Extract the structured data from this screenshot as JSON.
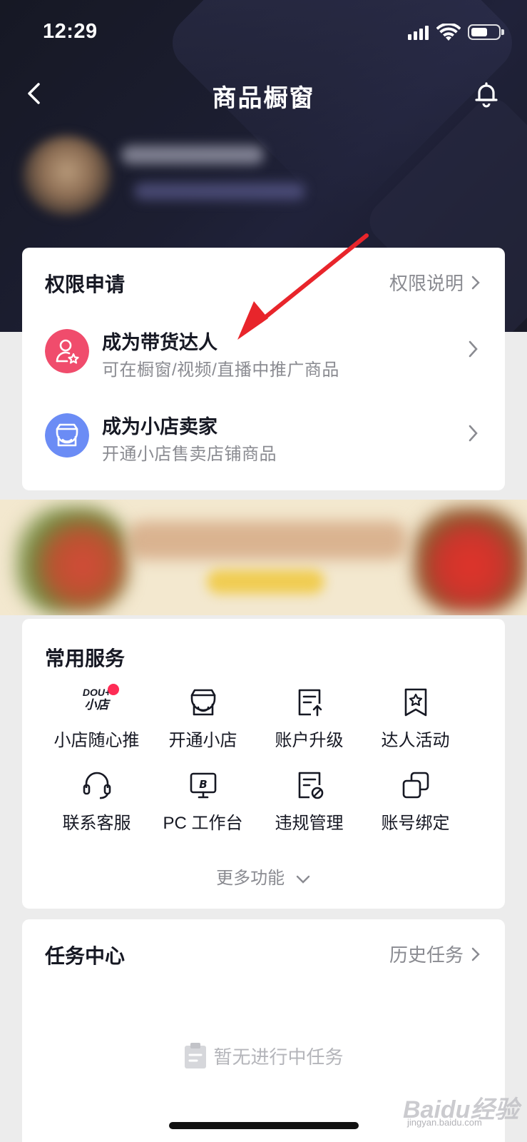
{
  "status_bar": {
    "time": "12:29"
  },
  "nav": {
    "title": "商品橱窗"
  },
  "permissions": {
    "title": "权限申请",
    "link": "权限说明",
    "items": [
      {
        "title": "成为带货达人",
        "subtitle": "可在橱窗/视频/直播中推广商品",
        "icon": "user-star-icon",
        "color": "#f04c6c"
      },
      {
        "title": "成为小店卖家",
        "subtitle": "开通小店售卖店铺商品",
        "icon": "store-icon",
        "color": "#6b8cf5"
      }
    ]
  },
  "services": {
    "title": "常用服务",
    "logo_text": {
      "line1": "DOU+",
      "line2": "小店"
    },
    "items": [
      {
        "label": "小店随心推",
        "icon": "dou-plus-store-icon"
      },
      {
        "label": "开通小店",
        "icon": "store-icon"
      },
      {
        "label": "账户升级",
        "icon": "account-upgrade-icon"
      },
      {
        "label": "达人活动",
        "icon": "talent-activity-icon"
      },
      {
        "label": "联系客服",
        "icon": "headset-icon"
      },
      {
        "label": "PC 工作台",
        "icon": "pc-workbench-icon"
      },
      {
        "label": "违规管理",
        "icon": "violation-icon"
      },
      {
        "label": "账号绑定",
        "icon": "account-bind-icon"
      }
    ],
    "more": "更多功能"
  },
  "tasks": {
    "title": "任务中心",
    "link": "历史任务",
    "empty": "暂无进行中任务"
  },
  "watermark": {
    "brand": "Baidu经验",
    "url": "jingyan.baidu.com"
  },
  "colors": {
    "accent": "#fe2c55",
    "header_bg": "#1a1c2c",
    "annotation_arrow": "#e8252b"
  }
}
